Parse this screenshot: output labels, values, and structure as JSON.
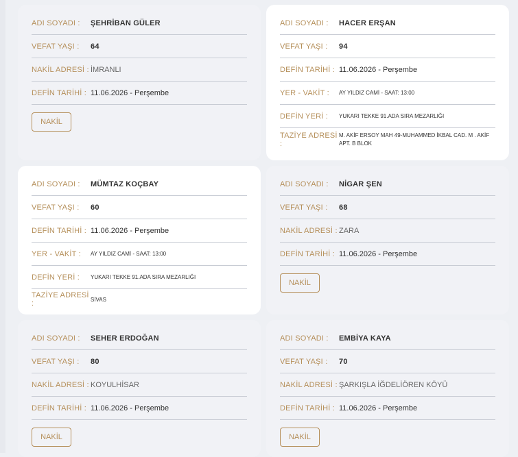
{
  "cards": [
    {
      "name": "ŞEHRİBAN GÜLER",
      "rows": [
        {
          "label": "ADI SOYADI :",
          "value": "ŞEHRİBAN GÜLER"
        },
        {
          "label": "VEFAT YAŞI :",
          "value": "64"
        },
        {
          "label": "NAKİL ADRESİ :",
          "value": "İMRANLI"
        },
        {
          "label": "DEFİN TARİHİ :",
          "value": "11.06.2026 - Perşembe"
        }
      ],
      "button": "NAKİL"
    },
    {
      "name": "HACER ERŞAN",
      "rows": [
        {
          "label": "ADI SOYADI :",
          "value": "HACER ERŞAN"
        },
        {
          "label": "VEFAT YAŞI :",
          "value": "94"
        },
        {
          "label": "DEFİN TARİHİ :",
          "value": "11.06.2026 - Perşembe"
        },
        {
          "label": "YER - VAKİT :",
          "value": "AY YILDIZ CAMİ - SAAT: 13:00"
        },
        {
          "label": "DEFİN YERİ :",
          "value": "YUKARI TEKKE 91.ADA SIRA MEZARLIĞI"
        },
        {
          "label": "TAZİYE ADRESİ :",
          "value": "M. AKİF ERSOY MAH 49-MUHAMMED İKBAL CAD. M . AKİF APT. B BLOK"
        }
      ]
    },
    {
      "name": "MÜMTAZ KOÇBAY",
      "rows": [
        {
          "label": "ADI SOYADI :",
          "value": "MÜMTAZ KOÇBAY"
        },
        {
          "label": "VEFAT YAŞI :",
          "value": "60"
        },
        {
          "label": "DEFİN TARİHİ :",
          "value": "11.06.2026 - Perşembe"
        },
        {
          "label": "YER - VAKİT :",
          "value": "AY YILDIZ CAMİ - SAAT: 13:00"
        },
        {
          "label": "DEFİN YERİ :",
          "value": "YUKARI TEKKE 91.ADA SIRA MEZARLIĞI"
        },
        {
          "label": "TAZİYE ADRESİ :",
          "value": "SİVAS"
        }
      ]
    },
    {
      "name": "NİGAR ŞEN",
      "rows": [
        {
          "label": "ADI SOYADI :",
          "value": "NİGAR ŞEN"
        },
        {
          "label": "VEFAT YAŞI :",
          "value": "68"
        },
        {
          "label": "NAKİL ADRESİ :",
          "value": "ZARA"
        },
        {
          "label": "DEFİN TARİHİ :",
          "value": "11.06.2026 - Perşembe"
        }
      ],
      "button": "NAKİL"
    },
    {
      "name": "SEHER ERDOĞAN",
      "rows": [
        {
          "label": "ADI SOYADI :",
          "value": "SEHER ERDOĞAN"
        },
        {
          "label": "VEFAT YAŞI :",
          "value": "80"
        },
        {
          "label": "NAKİL ADRESİ :",
          "value": "KOYULHİSAR"
        },
        {
          "label": "DEFİN TARİHİ :",
          "value": "11.06.2026 - Perşembe"
        }
      ],
      "button": "NAKİL"
    },
    {
      "name": "EMBİYA KAYA",
      "rows": [
        {
          "label": "ADI SOYADI :",
          "value": "EMBİYA KAYA"
        },
        {
          "label": "VEFAT YAŞI :",
          "value": "70"
        },
        {
          "label": "NAKİL ADRESİ :",
          "value": "ŞARKIŞLA İĞDELİÖREN KÖYÜ"
        },
        {
          "label": "DEFİN TARİHİ :",
          "value": "11.06.2026 - Perşembe"
        }
      ],
      "button": "NAKİL"
    }
  ],
  "colors": {
    "label": "#b58f5a",
    "value": "#333333",
    "divider": "#c8ccd4",
    "card_white": "#ffffff",
    "card_gray": "#f1f2f6",
    "page_bg": "#eef0f4"
  }
}
